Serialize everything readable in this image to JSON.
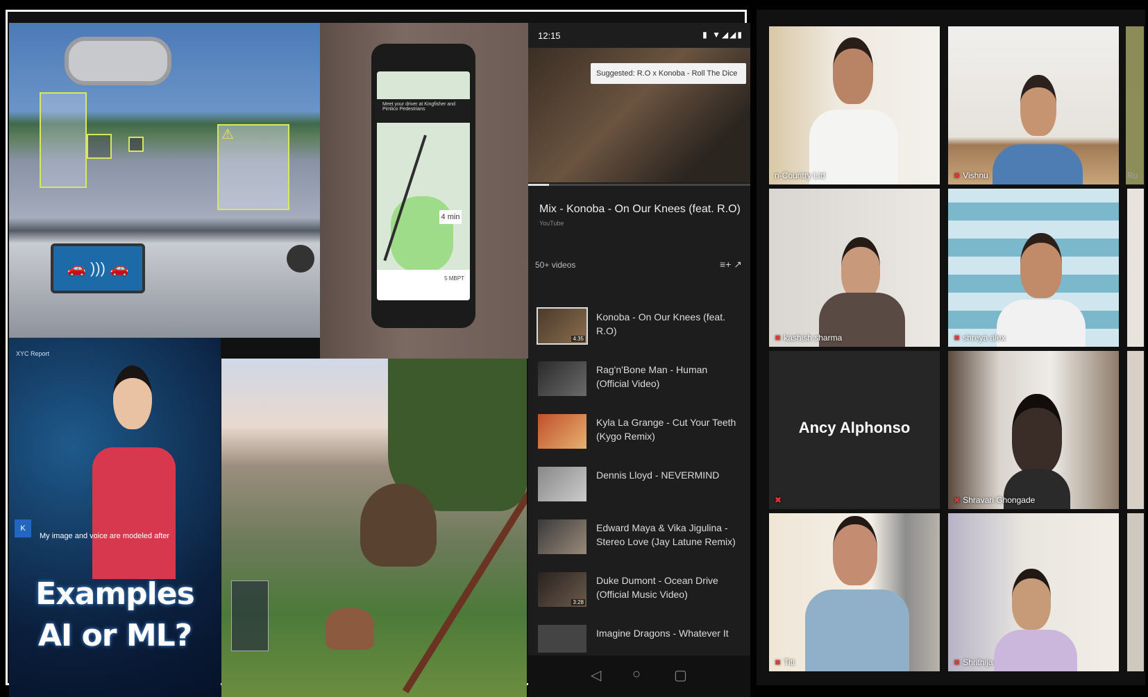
{
  "collage": {
    "phone_banner_text": "Meet your driver at Kingfisher and Pimlico Pedestrians",
    "phone_eta": "4 min",
    "phone_card_text": "5 MBPT",
    "dash_icon": "car-sensor-icon",
    "warning_icon": "⚠",
    "anchor_logo": "XYC Report",
    "anchor_caption": "My image and voice are modeled after",
    "anchor_badge": "K",
    "examples_line1": "Examples",
    "examples_line2": "AI or ML?"
  },
  "youtube": {
    "time": "12:15",
    "status_icons": "▮ ▼◢◢▮",
    "suggested": "Suggested: R.O x Konoba - Roll The Dice",
    "mix_title": "Mix - Konoba - On Our Knees (feat. R.O)",
    "mix_subtitle": "YouTube",
    "video_count": "50+ videos",
    "queue_icons": "≡+  ↗",
    "items": [
      {
        "title": "Konoba - On Our Knees (feat. R.O)",
        "duration": "4:35"
      },
      {
        "title": "Rag'n'Bone Man - Human (Official Video)",
        "duration": ""
      },
      {
        "title": "Kyla La Grange - Cut Your Teeth (Kygo Remix)",
        "duration": ""
      },
      {
        "title": "Dennis Lloyd - NEVERMIND",
        "duration": ""
      },
      {
        "title": "Edward Maya & Vika Jigulina - Stereo Love (Jay Latune Remix)",
        "duration": ""
      },
      {
        "title": "Duke Dumont - Ocean Drive (Official Music Video)",
        "duration": "3:28"
      },
      {
        "title": "Imagine Dragons - Whatever It",
        "duration": ""
      }
    ],
    "nav_back": "◁",
    "nav_home": "○",
    "nav_recent": "▢"
  },
  "zoom": {
    "tiles": [
      {
        "name": "n-Country Ltd",
        "muted": false
      },
      {
        "name": "Vishnu",
        "muted": true
      },
      {
        "name": "kashish sharma",
        "muted": true
      },
      {
        "name": "shreya alex",
        "muted": true
      },
      {
        "name": "Ancy Alphonso",
        "muted": true
      },
      {
        "name": "Shravari Ghongade",
        "muted": true
      },
      {
        "name": "Titi",
        "muted": true
      },
      {
        "name": "Shrithija",
        "muted": true
      }
    ],
    "edge_names": [
      "Ru"
    ],
    "mic_icon": "✖"
  }
}
